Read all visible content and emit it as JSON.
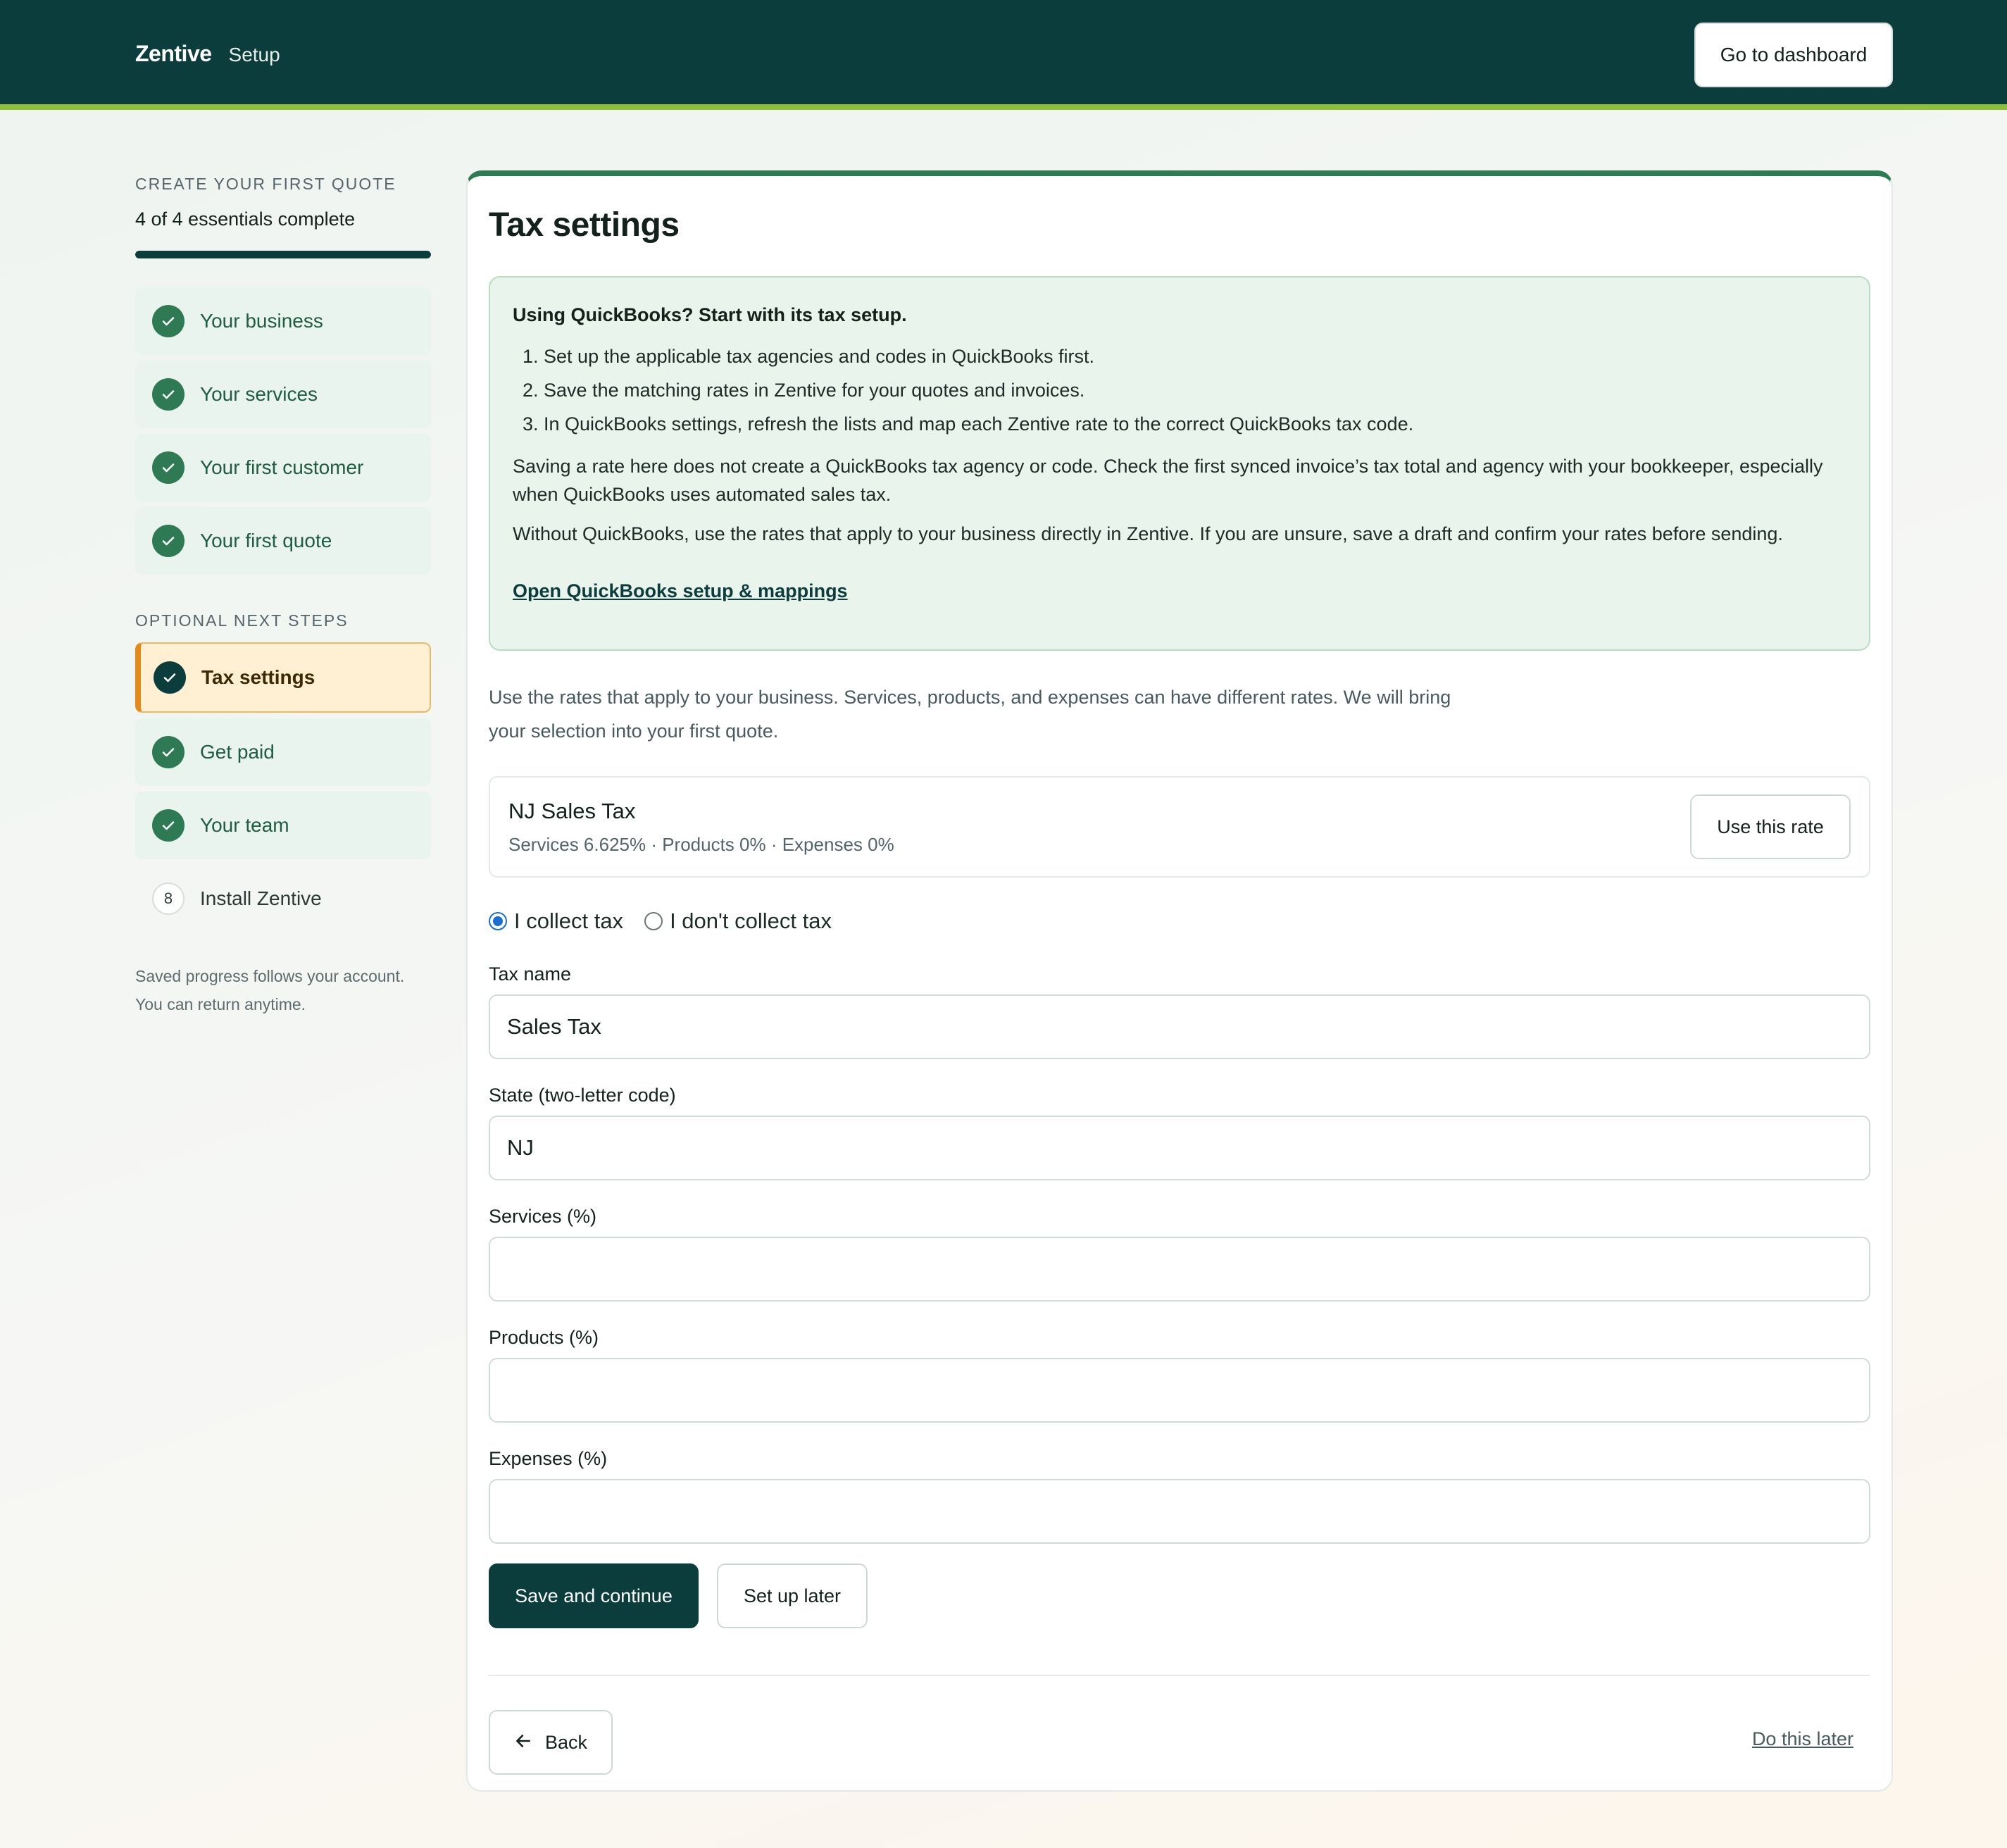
{
  "header": {
    "brand": "Zentive",
    "section": "Setup",
    "dashboard_button": "Go to dashboard"
  },
  "sidebar": {
    "essentials_heading": "CREATE YOUR FIRST QUOTE",
    "progress_text": "4 of 4 essentials complete",
    "progress_fraction": 1.0,
    "essentials": [
      {
        "label": "Your business",
        "state": "complete"
      },
      {
        "label": "Your services",
        "state": "complete"
      },
      {
        "label": "Your first customer",
        "state": "complete"
      },
      {
        "label": "Your first quote",
        "state": "complete"
      }
    ],
    "optional_heading": "OPTIONAL NEXT STEPS",
    "optional": [
      {
        "label": "Tax settings",
        "state": "active"
      },
      {
        "label": "Get paid",
        "state": "complete"
      },
      {
        "label": "Your team",
        "state": "complete"
      },
      {
        "label": "Install Zentive",
        "state": "pending",
        "number": "8"
      }
    ],
    "note_line1": "Saved progress follows your account.",
    "note_line2": "You can return anytime."
  },
  "main": {
    "title": "Tax settings",
    "info": {
      "heading": "Using QuickBooks? Start with its tax setup.",
      "steps": [
        "1. Set up the applicable tax agencies and codes in QuickBooks first.",
        "2. Save the matching rates in Zentive for your quotes and invoices.",
        "3. In QuickBooks settings, refresh the lists and map each Zentive rate to the correct QuickBooks tax code."
      ],
      "paragraph1": "Saving a rate here does not create a QuickBooks tax agency or code. Check the first synced invoice’s tax total and agency with your bookkeeper, especially when QuickBooks uses automated sales tax.",
      "paragraph2": "Without QuickBooks, use the rates that apply to your business directly in Zentive. If you are unsure, save a draft and confirm your rates before sending.",
      "link": "Open QuickBooks setup & mappings"
    },
    "intro": "Use the rates that apply to your business. Services, products, and expenses can have different rates. We will bring your selection into your first quote.",
    "suggested_rate": {
      "name": "NJ Sales Tax",
      "details": "Services 6.625% · Products 0% · Expenses 0%",
      "button": "Use this rate"
    },
    "radios": {
      "collect": "I collect tax",
      "no_collect": "I don't collect tax",
      "selected": "collect"
    },
    "fields": {
      "tax_name_label": "Tax name",
      "tax_name_value": "Sales Tax",
      "state_label": "State (two-letter code)",
      "state_value": "NJ",
      "services_label": "Services (%)",
      "services_value": "",
      "products_label": "Products (%)",
      "products_value": "",
      "expenses_label": "Expenses (%)",
      "expenses_value": ""
    },
    "actions": {
      "save": "Save and continue",
      "later": "Set up later",
      "back": "Back",
      "do_later": "Do this later"
    }
  },
  "colors": {
    "header_bg": "#0c3d3d",
    "header_accent": "#8fbe3d",
    "success": "#2d7a55",
    "active_accent": "#e58a1a",
    "info_bg": "#e9f4ec",
    "radio_selected": "#1a6fd1"
  },
  "icons": {
    "complete": "check-icon",
    "back": "arrow-left-icon"
  }
}
